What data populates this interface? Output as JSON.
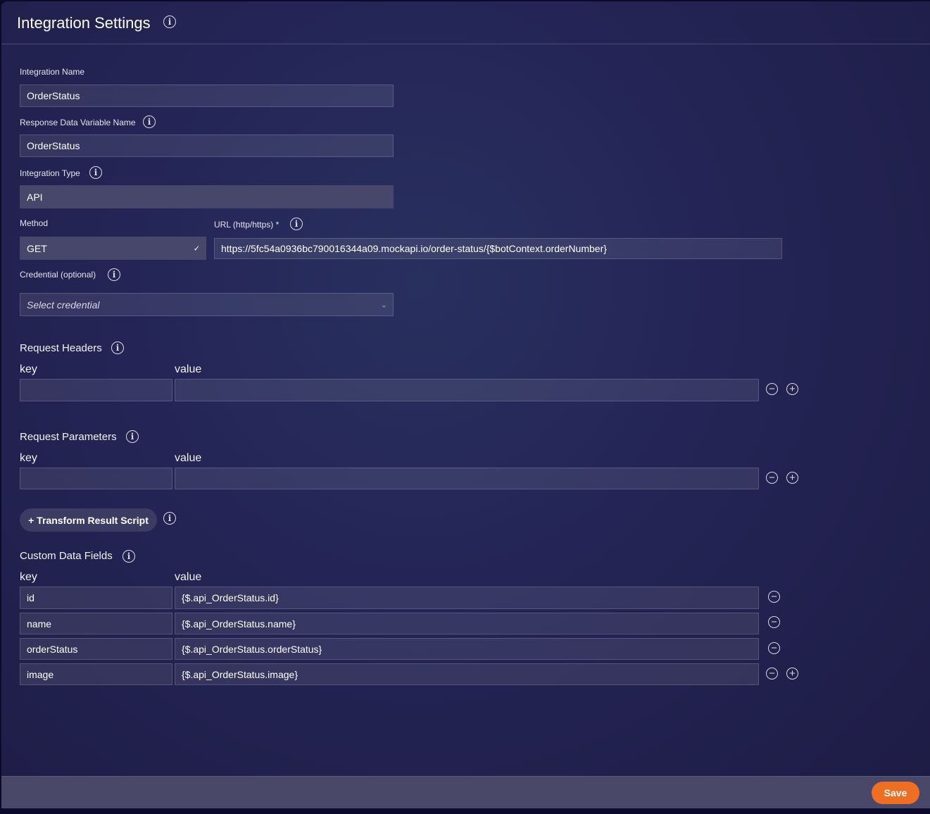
{
  "header": {
    "title": "Integration Settings"
  },
  "fields": {
    "integration_name": {
      "label": "Integration Name",
      "value": "OrderStatus"
    },
    "response_var": {
      "label": "Response Data Variable Name",
      "value": "OrderStatus"
    },
    "integration_type": {
      "label": "Integration Type",
      "value": "API"
    },
    "method": {
      "label": "Method",
      "value": "GET"
    },
    "url": {
      "label": "URL (http/https) *",
      "value": "https://5fc54a0936bc790016344a09.mockapi.io/order-status/{$botContext.orderNumber}"
    },
    "credential": {
      "label": "Credential (optional)",
      "placeholder": "Select credential"
    }
  },
  "request_headers": {
    "title": "Request Headers",
    "key_label": "key",
    "value_label": "value"
  },
  "request_parameters": {
    "title": "Request Parameters",
    "key_label": "key",
    "value_label": "value"
  },
  "transform_button": "+ Transform Result Script",
  "custom_fields": {
    "title": "Custom Data Fields",
    "key_label": "key",
    "value_label": "value",
    "rows": [
      {
        "key": "id",
        "value": "{$.api_OrderStatus.id}"
      },
      {
        "key": "name",
        "value": "{$.api_OrderStatus.name}"
      },
      {
        "key": "orderStatus",
        "value": "{$.api_OrderStatus.orderStatus}"
      },
      {
        "key": "image",
        "value": "{$.api_OrderStatus.image}"
      }
    ]
  },
  "footer": {
    "save_label": "Save"
  },
  "colors": {
    "accent": "#ee6f22",
    "background": "#242556"
  }
}
